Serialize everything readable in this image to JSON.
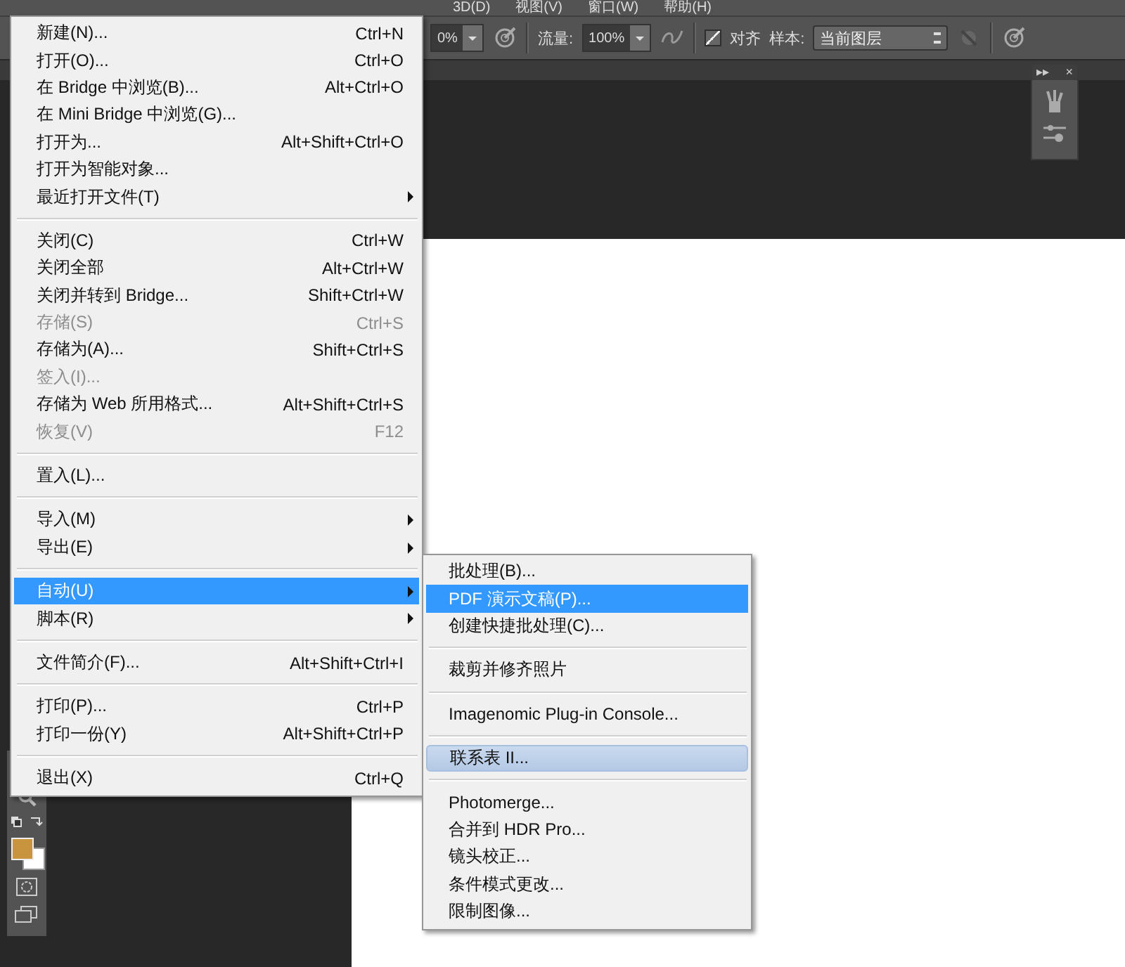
{
  "menu_bar": [
    "3D(D)",
    "视图(V)",
    "窗口(W)",
    "帮助(H)"
  ],
  "floating_panel": {
    "collapse_glyph": "▸▸",
    "close_glyph": "×"
  },
  "options_bar": {
    "opacity_value": "0%",
    "flow_label": "流量:",
    "flow_value": "100%",
    "align": {
      "label": "对齐",
      "checked": true
    },
    "sample_label": "样本:",
    "sample_value": "当前图层"
  },
  "file_menu": [
    {
      "kind": "item",
      "label": "新建(N)...",
      "shortcut": "Ctrl+N",
      "disabled": false,
      "selected": false,
      "submenu": false
    },
    {
      "kind": "item",
      "label": "打开(O)...",
      "shortcut": "Ctrl+O",
      "disabled": false,
      "selected": false,
      "submenu": false
    },
    {
      "kind": "item",
      "label": "在 Bridge 中浏览(B)...",
      "shortcut": "Alt+Ctrl+O",
      "disabled": false,
      "selected": false,
      "submenu": false
    },
    {
      "kind": "item",
      "label": "在 Mini Bridge 中浏览(G)...",
      "disabled": false,
      "selected": false,
      "submenu": false
    },
    {
      "kind": "item",
      "label": "打开为...",
      "shortcut": "Alt+Shift+Ctrl+O",
      "disabled": false,
      "selected": false,
      "submenu": false
    },
    {
      "kind": "item",
      "label": "打开为智能对象...",
      "disabled": false,
      "selected": false,
      "submenu": false
    },
    {
      "kind": "item",
      "label": "最近打开文件(T)",
      "disabled": false,
      "selected": false,
      "submenu": true
    },
    {
      "kind": "separator"
    },
    {
      "kind": "item",
      "label": "关闭(C)",
      "shortcut": "Ctrl+W",
      "disabled": false,
      "selected": false,
      "submenu": false
    },
    {
      "kind": "item",
      "label": "关闭全部",
      "shortcut": "Alt+Ctrl+W",
      "disabled": false,
      "selected": false,
      "submenu": false
    },
    {
      "kind": "item",
      "label": "关闭并转到 Bridge...",
      "shortcut": "Shift+Ctrl+W",
      "disabled": false,
      "selected": false,
      "submenu": false
    },
    {
      "kind": "item",
      "label": "存储(S)",
      "shortcut": "Ctrl+S",
      "disabled": true,
      "selected": false,
      "submenu": false
    },
    {
      "kind": "item",
      "label": "存储为(A)...",
      "shortcut": "Shift+Ctrl+S",
      "disabled": false,
      "selected": false,
      "submenu": false
    },
    {
      "kind": "item",
      "label": "签入(I)...",
      "disabled": true,
      "selected": false,
      "submenu": false
    },
    {
      "kind": "item",
      "label": "存储为 Web 所用格式...",
      "shortcut": "Alt+Shift+Ctrl+S",
      "disabled": false,
      "selected": false,
      "submenu": false
    },
    {
      "kind": "item",
      "label": "恢复(V)",
      "shortcut": "F12",
      "disabled": true,
      "selected": false,
      "submenu": false
    },
    {
      "kind": "separator"
    },
    {
      "kind": "item",
      "label": "置入(L)...",
      "disabled": false,
      "selected": false,
      "submenu": false
    },
    {
      "kind": "separator"
    },
    {
      "kind": "item",
      "label": "导入(M)",
      "disabled": false,
      "selected": false,
      "submenu": true
    },
    {
      "kind": "item",
      "label": "导出(E)",
      "disabled": false,
      "selected": false,
      "submenu": true
    },
    {
      "kind": "separator"
    },
    {
      "kind": "item",
      "label": "自动(U)",
      "disabled": false,
      "selected": true,
      "submenu": true
    },
    {
      "kind": "item",
      "label": "脚本(R)",
      "disabled": false,
      "selected": false,
      "submenu": true
    },
    {
      "kind": "separator"
    },
    {
      "kind": "item",
      "label": "文件简介(F)...",
      "shortcut": "Alt+Shift+Ctrl+I",
      "disabled": false,
      "selected": false,
      "submenu": false
    },
    {
      "kind": "separator"
    },
    {
      "kind": "item",
      "label": "打印(P)...",
      "shortcut": "Ctrl+P",
      "disabled": false,
      "selected": false,
      "submenu": false
    },
    {
      "kind": "item",
      "label": "打印一份(Y)",
      "shortcut": "Alt+Shift+Ctrl+P",
      "disabled": false,
      "selected": false,
      "submenu": false
    },
    {
      "kind": "separator"
    },
    {
      "kind": "item",
      "label": "退出(X)",
      "shortcut": "Ctrl+Q",
      "disabled": false,
      "selected": false,
      "submenu": false
    }
  ],
  "automate_submenu": [
    {
      "kind": "item",
      "label": "批处理(B)...",
      "selected": false,
      "hovered": false
    },
    {
      "kind": "item",
      "label": "PDF 演示文稿(P)...",
      "selected": true,
      "hovered": false
    },
    {
      "kind": "item",
      "label": "创建快捷批处理(C)...",
      "selected": false,
      "hovered": false
    },
    {
      "kind": "separator"
    },
    {
      "kind": "item",
      "label": "裁剪并修齐照片",
      "selected": false,
      "hovered": false
    },
    {
      "kind": "separator"
    },
    {
      "kind": "item",
      "label": "Imagenomic Plug-in Console...",
      "selected": false,
      "hovered": false
    },
    {
      "kind": "separator"
    },
    {
      "kind": "item",
      "label": "联系表 II...",
      "selected": false,
      "hovered": true
    },
    {
      "kind": "separator"
    },
    {
      "kind": "item",
      "label": "Photomerge...",
      "selected": false,
      "hovered": false
    },
    {
      "kind": "item",
      "label": "合并到 HDR Pro...",
      "selected": false,
      "hovered": false
    },
    {
      "kind": "item",
      "label": "镜头校正...",
      "selected": false,
      "hovered": false
    },
    {
      "kind": "item",
      "label": "条件模式更改...",
      "selected": false,
      "hovered": false
    },
    {
      "kind": "item",
      "label": "限制图像...",
      "selected": false,
      "hovered": false
    }
  ]
}
